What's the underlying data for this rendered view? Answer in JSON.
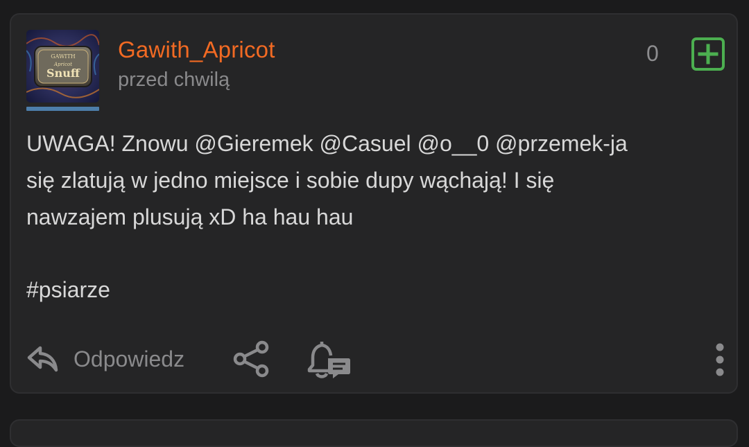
{
  "post": {
    "author": "Gawith_Apricot",
    "timestamp": "przed chwilą",
    "vote_count": "0",
    "body_lines": [
      "UWAGA! Znowu @Gieremek @Casuel @o__0 @przemek-ja",
      "się zlatują w jedno miejsce i sobie dupy wąchają! I się",
      "nawzajem plusują xD ha hau hau"
    ],
    "tag": "#psiarze",
    "avatar_text": {
      "top": "GAWITH",
      "middle": "Apricot",
      "bottom": "Snuff"
    }
  },
  "actions": {
    "reply_label": "Odpowiedz",
    "reply_icon": "reply-arrow-icon",
    "share_icon": "share-icon",
    "notify_icon": "bell-comment-icon",
    "more_icon": "more-vertical-icon",
    "plus_icon": "plus-square-icon"
  },
  "colors": {
    "background": "#1b1b1c",
    "card": "#252526",
    "username": "#f26a23",
    "muted": "#8a8a8c",
    "text": "#d8d8d8",
    "plus": "#4caf50",
    "avatar_underline": "#4d7eaa"
  }
}
